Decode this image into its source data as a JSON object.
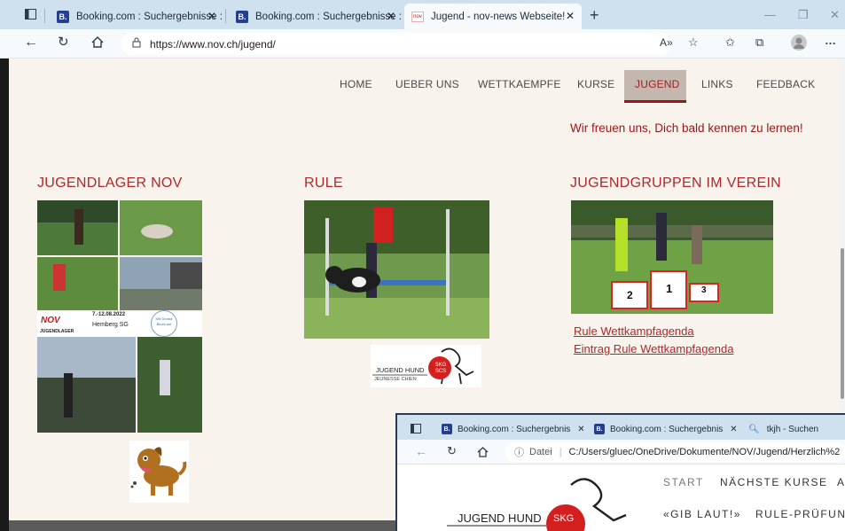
{
  "browser": {
    "tabs": [
      {
        "favicon": "B.",
        "title": "Booking.com : Suchergebnisse : "
      },
      {
        "favicon": "B.",
        "title": "Booking.com : Suchergebnisse : "
      },
      {
        "favicon": "nov",
        "title": "Jugend - nov-news Webseite!"
      }
    ],
    "url": "https://www.nov.ch/jugend/",
    "new_tab": "+",
    "close": "✕",
    "reader": "A»"
  },
  "site": {
    "nav": [
      "HOME",
      "UEBER UNS",
      "WETTKAEMPFE",
      "KURSE",
      "JUGEND",
      "LINKS",
      "FEEDBACK"
    ],
    "active_nav": "JUGEND",
    "welcome": "Wir freuen uns, Dich bald kennen zu lernen!",
    "sections": {
      "lager": {
        "title": "JUGENDLAGER NOV",
        "poster_text": "7.-12.08.2022",
        "poster_place": "Hemberg SG",
        "poster_brand": "NOV",
        "poster_sub": "JUGENDLAGER",
        "poster_badge": "Mit Grossii Blues auf"
      },
      "rule": {
        "title": "RULE",
        "logo_text": "JUGEND HUND",
        "logo_sub": "JEUNESSE CHIEN",
        "logo_ball": "SKG SCS"
      },
      "gruppen": {
        "title": "JUGENDGRUPPEN IM VEREIN",
        "podium": [
          "2",
          "1",
          "3"
        ],
        "links": [
          "Rule Wettkampfagenda",
          "Eintrag Rule Wettkampfagenda"
        ]
      }
    }
  },
  "window2": {
    "tabs": [
      {
        "favicon": "B.",
        "title": "Booking.com : Suchergebnis"
      },
      {
        "favicon": "B.",
        "title": "Booking.com : Suchergebnis"
      },
      {
        "favicon": "search",
        "title": "tkjh - Suchen"
      }
    ],
    "url_prefix": "Datei",
    "url": "C:/Users/gluec/OneDrive/Dokumente/NOV/Jugend/Herzlich%2",
    "nav_row1": [
      "START",
      "NÄCHSTE KURSE",
      "A"
    ],
    "nav_row2": [
      "«GIB LAUT!»",
      "RULE-PRÜFUN"
    ],
    "logo_text": "JUGEND HUND",
    "logo_ball": "SKG"
  },
  "colors": {
    "accent": "#b0282b",
    "nav_active_bg": "#c4b7af",
    "page_bg": "#f8f3ec",
    "tabbar": "#cfe0ef"
  }
}
